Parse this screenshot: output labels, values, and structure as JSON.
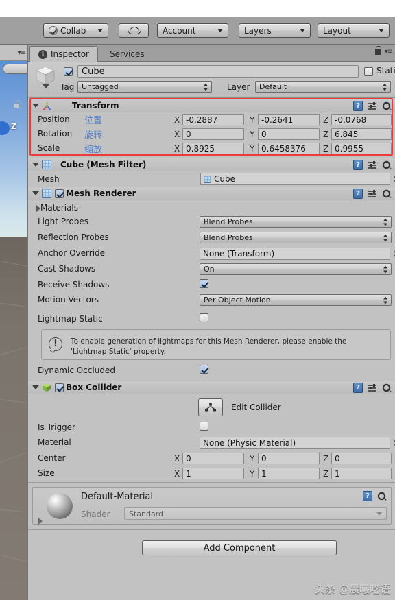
{
  "toolbar": {
    "collab_label": "Collab",
    "collab_icon": "check-circle-icon",
    "cloud_icon": "cloud-icon",
    "account_label": "Account",
    "layers_label": "Layers",
    "layout_label": "Layout"
  },
  "panel": {
    "tabs": [
      {
        "label": "Inspector",
        "icon": "info-icon",
        "active": true
      },
      {
        "label": "Services",
        "icon": "",
        "active": false
      }
    ],
    "lock_icon": "lock-icon",
    "menu_icon": "panel-menu-icon"
  },
  "object_header": {
    "enabled": true,
    "name": "Cube",
    "static_label": "Static",
    "static_checked": false,
    "tag_label": "Tag",
    "tag_value": "Untagged",
    "layer_label": "Layer",
    "layer_value": "Default"
  },
  "transform": {
    "title": "Transform",
    "icon": "transform-axis-icon",
    "rows": [
      {
        "label": "Position",
        "zh": "位置",
        "x": "-0.2887",
        "y": "-0.2641",
        "z": "-0.0768"
      },
      {
        "label": "Rotation",
        "zh": "旋转",
        "x": "0",
        "y": "0",
        "z": "6.845"
      },
      {
        "label": "Scale",
        "zh": "缩放",
        "x": "0.8925",
        "y": "0.6458376",
        "z": "0.9955"
      }
    ],
    "axis_x": "X",
    "axis_y": "Y",
    "axis_z": "Z",
    "highlight_color": "#ef3b3b"
  },
  "mesh_filter": {
    "title": "Cube (Mesh Filter)",
    "icon": "mesh-filter-icon",
    "mesh_label": "Mesh",
    "mesh_value": "Cube"
  },
  "mesh_renderer": {
    "title": "Mesh Renderer",
    "icon": "mesh-renderer-icon",
    "enabled": true,
    "materials_label": "Materials",
    "light_probes_label": "Light Probes",
    "light_probes_value": "Blend Probes",
    "reflection_probes_label": "Reflection Probes",
    "reflection_probes_value": "Blend Probes",
    "anchor_override_label": "Anchor Override",
    "anchor_override_value": "None (Transform)",
    "cast_shadows_label": "Cast Shadows",
    "cast_shadows_value": "On",
    "receive_shadows_label": "Receive Shadows",
    "receive_shadows_checked": true,
    "motion_vectors_label": "Motion Vectors",
    "motion_vectors_value": "Per Object Motion",
    "lightmap_static_label": "Lightmap Static",
    "lightmap_static_checked": false,
    "help_icon": "warning-icon",
    "help_text": "To enable generation of lightmaps for this Mesh Renderer, please enable the 'Lightmap Static' property.",
    "dynamic_occluded_label": "Dynamic Occluded",
    "dynamic_occluded_checked": true
  },
  "box_collider": {
    "title": "Box Collider",
    "icon": "box-collider-icon",
    "enabled": true,
    "edit_collider_label": "Edit Collider",
    "edit_collider_icon": "edit-collider-icon",
    "is_trigger_label": "Is Trigger",
    "is_trigger_checked": false,
    "material_label": "Material",
    "material_value": "None (Physic Material)",
    "center_label": "Center",
    "center": {
      "x": "0",
      "y": "0",
      "z": "0"
    },
    "size_label": "Size",
    "size": {
      "x": "1",
      "y": "1",
      "z": "1"
    },
    "axis_x": "X",
    "axis_y": "Y",
    "axis_z": "Z"
  },
  "material_block": {
    "name": "Default-Material",
    "shader_label": "Shader",
    "shader_value": "Standard"
  },
  "footer": {
    "add_component_label": "Add Component",
    "watermark": "头条 @晨曦呓语"
  },
  "scene_sliver": {
    "gizmo_axis_label": "Z"
  }
}
